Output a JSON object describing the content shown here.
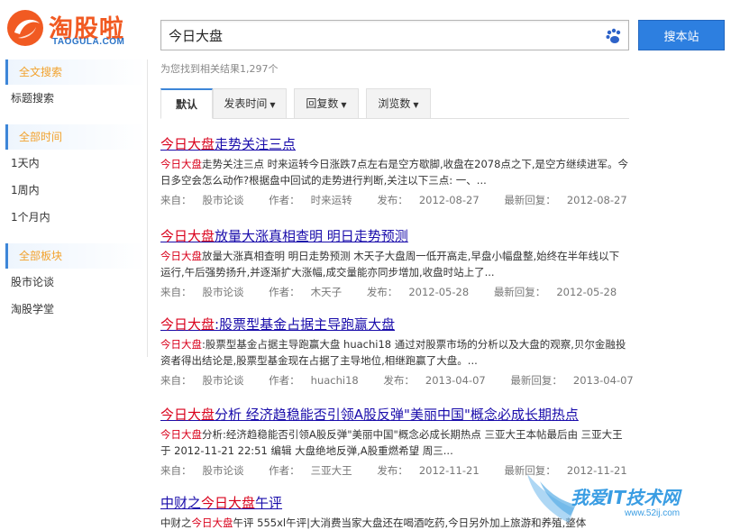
{
  "header": {
    "logo_text": "淘股啦",
    "logo_sub": "TAOGULA.COM",
    "search_value": "今日大盘",
    "search_button": "搜本站"
  },
  "result_count": "为您找到相关结果1,297个",
  "sidebar": {
    "groups": [
      {
        "head": "全文搜索",
        "items": [
          "标题搜索"
        ]
      },
      {
        "head": "全部时间",
        "items": [
          "1天内",
          "1周内",
          "1个月内"
        ]
      },
      {
        "head": "全部板块",
        "items": [
          "股市论谈",
          "淘股学堂"
        ]
      }
    ]
  },
  "tabs": [
    "默认",
    "发表时间",
    "回复数",
    "浏览数"
  ],
  "labels": {
    "from": "来自：",
    "author": "作者：",
    "posted": "发布：",
    "replied": "最新回复："
  },
  "results": [
    {
      "title_hl": "今日大盘",
      "title_rest": "走势关注三点",
      "snippet_hl": "今日大盘",
      "snippet": "走势关注三点 时来运转今日涨跌7点左右是空方歇脚,收盘在2078点之下,是空方继续进军。今日多空会怎么动作?根据盘中回试的走势进行判断,关注以下三点: 一、...",
      "from": "股市论谈",
      "author": "时来运转",
      "posted": "2012-08-27",
      "replied": "2012-08-27"
    },
    {
      "title_hl": "今日大盘",
      "title_rest": "放量大涨真相查明 明日走势预测",
      "snippet_hl": "今日大盘",
      "snippet": "放量大涨真相查明 明日走势预测 木天子大盘周一低开高走,早盘小幅盘整,始终在半年线以下运行,午后强势扬升,并逐渐扩大涨幅,成交量能亦同步增加,收盘时站上了...",
      "from": "股市论谈",
      "author": "木天子",
      "posted": "2012-05-28",
      "replied": "2012-05-28"
    },
    {
      "title_hl": "今日大盘",
      "title_rest": ":股票型基金占据主导跑赢大盘",
      "snippet_hl": "今日大盘",
      "snippet": ":股票型基金占据主导跑赢大盘 huachi18 通过对股票市场的分析以及大盘的观察,贝尔金融投资者得出结论是,股票型基金现在占据了主导地位,相继跑赢了大盘。...",
      "from": "股市论谈",
      "author": "huachi18",
      "posted": "2013-04-07",
      "replied": "2013-04-07"
    },
    {
      "title_hl": "今日大盘",
      "title_rest": "分析 经济趋稳能否引领A股反弹\"美丽中国\"概念必成长期热点",
      "snippet_hl": "今日大盘",
      "snippet": "分析:经济趋稳能否引领A股反弹\"美丽中国\"概念必成长期热点 三亚大王本帖最后由 三亚大王 于 2012-11-21 22:51 编辑 大盘绝地反弹,A股重燃希望 周三...",
      "from": "股市论谈",
      "author": "三亚大王",
      "posted": "2012-11-21",
      "replied": "2012-11-21"
    },
    {
      "title_pre": "中财之",
      "title_hl": "今日大盘",
      "title_rest": "午评",
      "snippet_pre": "中财之",
      "snippet_hl": "今日大盘",
      "snippet": "午评 555xl午评|大消费当家大盘还在喝酒吃药,今日另外加上旅游和养殖,整体"
    }
  ],
  "watermark": {
    "text": "我爱IT技术网",
    "url": "www.52ij.com"
  }
}
